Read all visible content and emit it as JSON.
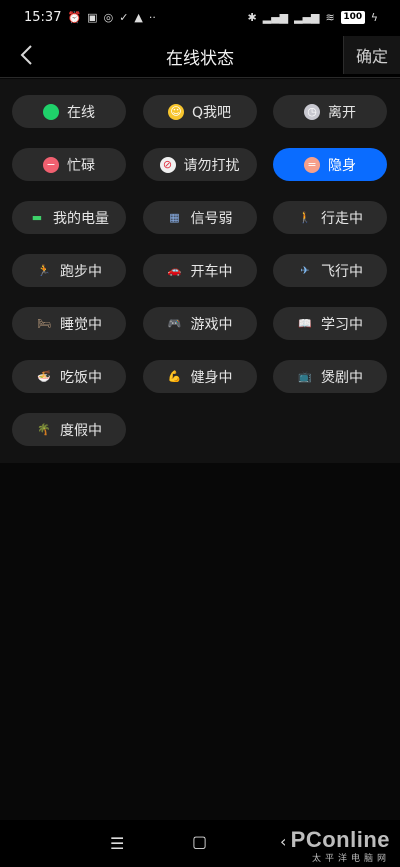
{
  "status_bar": {
    "time": "15:37",
    "battery": "100"
  },
  "header": {
    "title": "在线状态",
    "confirm_label": "确定"
  },
  "statuses": [
    {
      "label": "在线",
      "icon": "green-dot",
      "active": false
    },
    {
      "label": "Q我吧",
      "icon": "smile-face-emoji",
      "active": false
    },
    {
      "label": "离开",
      "icon": "clock-icon",
      "active": false
    },
    {
      "label": "忙碌",
      "icon": "minus-circle-icon",
      "active": false
    },
    {
      "label": "请勿打扰",
      "icon": "no-entry-icon",
      "active": false
    },
    {
      "label": "隐身",
      "icon": "equals-circle-icon",
      "active": true
    },
    {
      "label": "我的电量",
      "icon": "battery-icon",
      "active": false
    },
    {
      "label": "信号弱",
      "icon": "signal-icon",
      "active": false
    },
    {
      "label": "行走中",
      "icon": "walking-person-emoji",
      "active": false
    },
    {
      "label": "跑步中",
      "icon": "running-person-emoji",
      "active": false
    },
    {
      "label": "开车中",
      "icon": "car-emoji",
      "active": false
    },
    {
      "label": "飞行中",
      "icon": "airplane-emoji",
      "active": false
    },
    {
      "label": "睡觉中",
      "icon": "bed-emoji",
      "active": false
    },
    {
      "label": "游戏中",
      "icon": "gamepad-emoji",
      "active": false
    },
    {
      "label": "学习中",
      "icon": "book-emoji",
      "active": false
    },
    {
      "label": "吃饭中",
      "icon": "noodle-bowl-emoji",
      "active": false
    },
    {
      "label": "健身中",
      "icon": "flexed-bicep-emoji",
      "active": false
    },
    {
      "label": "煲剧中",
      "icon": "tv-emoji",
      "active": false
    },
    {
      "label": "度假中",
      "icon": "palm-tree-emoji",
      "active": false
    }
  ],
  "watermark": {
    "main": "PConline",
    "sub": "太平洋电脑网"
  },
  "colors": {
    "accent": "#0a6cff",
    "chip_bg": "#2b2b2b",
    "panel_bg": "#121212"
  }
}
